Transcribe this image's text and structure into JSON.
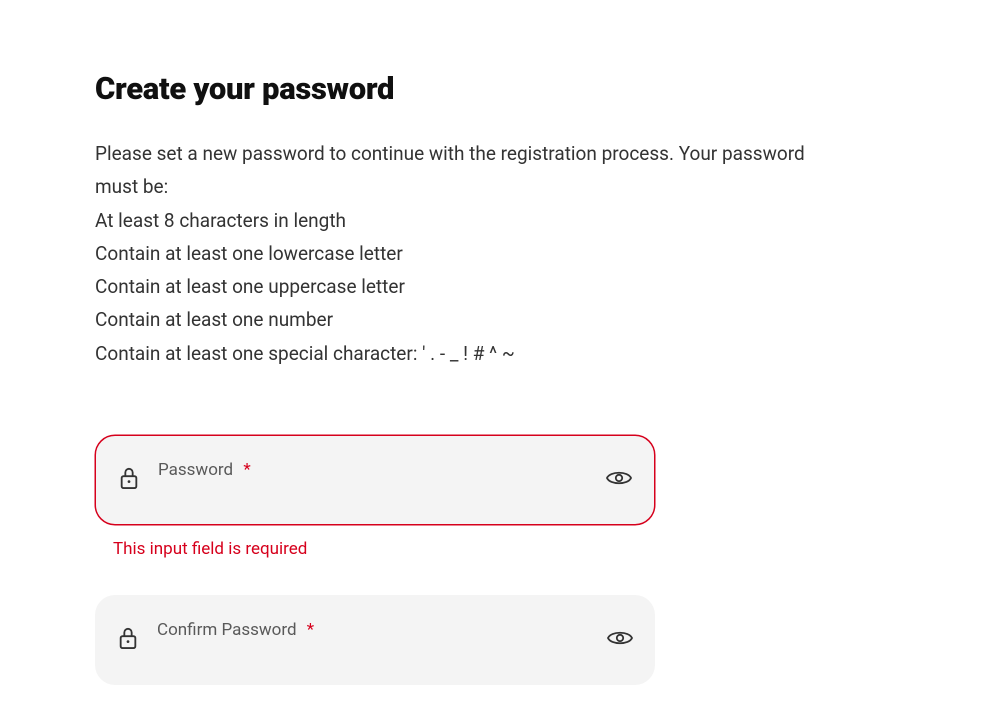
{
  "title": "Create your password",
  "intro": "Please set a new password to continue with the registration process. Your password must be:",
  "rules": [
    "At least 8 characters in length",
    "Contain at least one lowercase letter",
    "Contain at least one uppercase letter",
    "Contain at least one number",
    "Contain at least one special character: ' . - _ ! # ^ ~"
  ],
  "fields": {
    "password": {
      "label": "Password",
      "required_marker": "*",
      "value": "",
      "error": "This input field is required"
    },
    "confirm": {
      "label": "Confirm Password",
      "required_marker": "*",
      "value": ""
    }
  },
  "colors": {
    "error": "#d6001c",
    "bg_field": "#f4f4f4",
    "text": "#333333",
    "title": "#101010"
  }
}
